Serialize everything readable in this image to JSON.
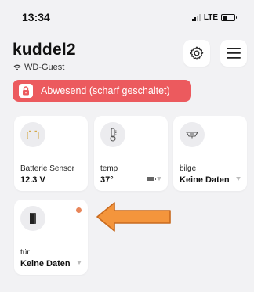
{
  "status_bar": {
    "time": "13:34",
    "network": "LTE",
    "battery_level": 0.45
  },
  "header": {
    "title": "kuddel2",
    "network_name": "WD-Guest",
    "settings_icon": "gear-icon",
    "menu_icon": "hamburger-menu-icon"
  },
  "alarm": {
    "label": "Abwesend (scharf geschaltet)",
    "icon": "lock-icon",
    "color": "#ec5a5e"
  },
  "tiles": [
    {
      "name": "Batterie Sensor",
      "value": "12.3 V",
      "icon": "battery-sensor-icon"
    },
    {
      "name": "temp",
      "value": "37°",
      "icon": "thermometer-icon"
    },
    {
      "name": "bilge",
      "value": "Keine Daten",
      "icon": "bilge-sensor-icon"
    },
    {
      "name": "tür",
      "value": "Keine Daten",
      "icon": "door-icon",
      "status_color": "#e8865a"
    }
  ],
  "annotation": {
    "arrow_color": "#f4953c",
    "arrow_icon": "left-arrow-icon"
  }
}
